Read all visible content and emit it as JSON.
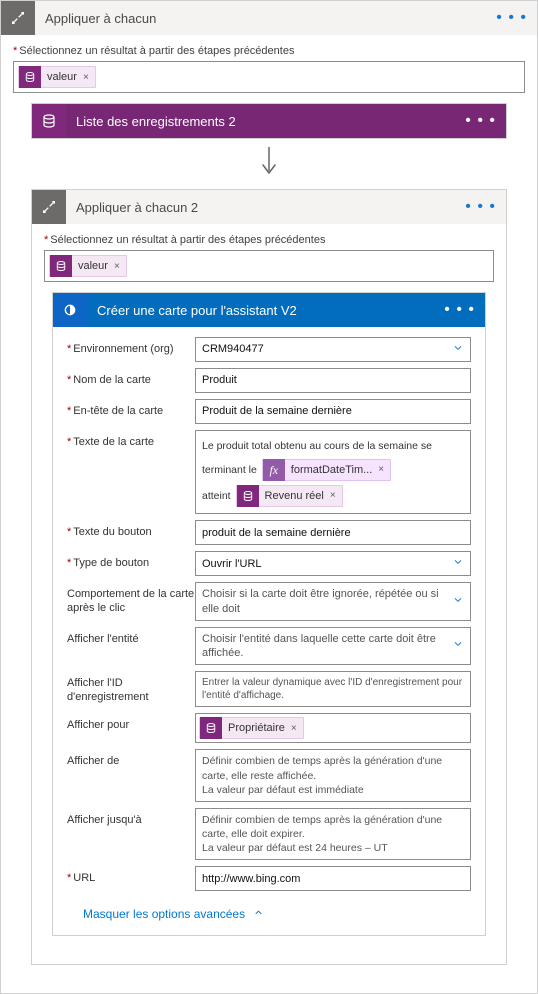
{
  "outer": {
    "title": "Appliquer à chacun",
    "selectLabel": "Sélectionnez un résultat à partir des étapes précédentes",
    "token": "valeur"
  },
  "listRecords": {
    "title": "Liste des enregistrements 2"
  },
  "inner": {
    "title": "Appliquer à chacun 2",
    "selectLabel": "Sélectionnez un résultat à partir des étapes précédentes",
    "token": "valeur"
  },
  "createCard": {
    "title": "Créer une carte pour l'assistant V2",
    "rows": {
      "env": {
        "label": "Environnement (org)",
        "value": "CRM940477"
      },
      "cardName": {
        "label": "Nom de la carte",
        "value": "Produit"
      },
      "cardHeader": {
        "label": "En-tête de la carte",
        "value": "Produit de la semaine dernière"
      },
      "cardText": {
        "label": "Texte de la carte",
        "pre": "Le produit total obtenu au cours de la semaine se terminant le",
        "fxToken": "formatDateTim...",
        "mid": "atteint",
        "revToken": "Revenu réel"
      },
      "buttonText": {
        "label": "Texte du bouton",
        "value": "produit de la semaine dernière"
      },
      "buttonType": {
        "label": "Type de bouton",
        "value": "Ouvrir l'URL"
      },
      "afterClick": {
        "label": "Comportement de la carte après le clic",
        "value": "Choisir si la carte doit être ignorée, répétée ou si elle doit"
      },
      "showEntity": {
        "label": "Afficher l'entité",
        "value": "Choisir l'entité dans laquelle cette carte doit être affichée."
      },
      "showRecordId": {
        "label": "Afficher l'ID d'enregistrement",
        "value": "Entrer la valeur dynamique avec l'ID d'enregistrement pour l'entité d'affichage."
      },
      "showFor": {
        "label": "Afficher pour",
        "token": "Propriétaire"
      },
      "showFrom": {
        "label": "Afficher de",
        "line1": "Définir combien de temps après la génération d'une carte, elle reste affichée.",
        "line2": "La valeur par défaut est immédiate"
      },
      "showUntil": {
        "label": "Afficher jusqu'à",
        "line1": "Définir combien de temps après la génération d'une carte, elle doit expirer.",
        "line2": "La valeur par défaut est 24 heures – UT"
      },
      "url": {
        "label": "URL",
        "value": "http://www.bing.com"
      }
    },
    "hideOptions": "Masquer les options avancées"
  }
}
